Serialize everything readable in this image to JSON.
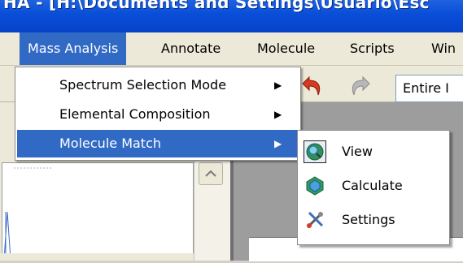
{
  "window": {
    "title": "HA - [H:\\Documents and Settings\\Usuario\\Esc"
  },
  "menubar": {
    "items": [
      {
        "label": "Mass Analysis",
        "active": true
      },
      {
        "label": "Annotate"
      },
      {
        "label": "Molecule"
      },
      {
        "label": "Scripts"
      },
      {
        "label": "Win"
      }
    ]
  },
  "toolbar": {
    "undo_icon": "undo-arrow-icon",
    "redo_icon": "redo-arrow-icon",
    "combo_value": "Entire I"
  },
  "dropdown": {
    "items": [
      {
        "label": "Spectrum Selection Mode",
        "arrow": "▶"
      },
      {
        "label": "Elemental Composition",
        "arrow": "▶"
      },
      {
        "label": "Molecule Match",
        "arrow": "▶",
        "highlighted": true
      }
    ]
  },
  "submenu": {
    "items": [
      {
        "label": "View",
        "icon": "view-molecule-icon"
      },
      {
        "label": "Calculate",
        "icon": "calculate-molecule-icon"
      },
      {
        "label": "Settings",
        "icon": "settings-tools-icon"
      }
    ]
  },
  "colors": {
    "titlebar": "#0a4fd9",
    "highlight": "#316ac5",
    "menu_bg": "#ece9d8"
  }
}
